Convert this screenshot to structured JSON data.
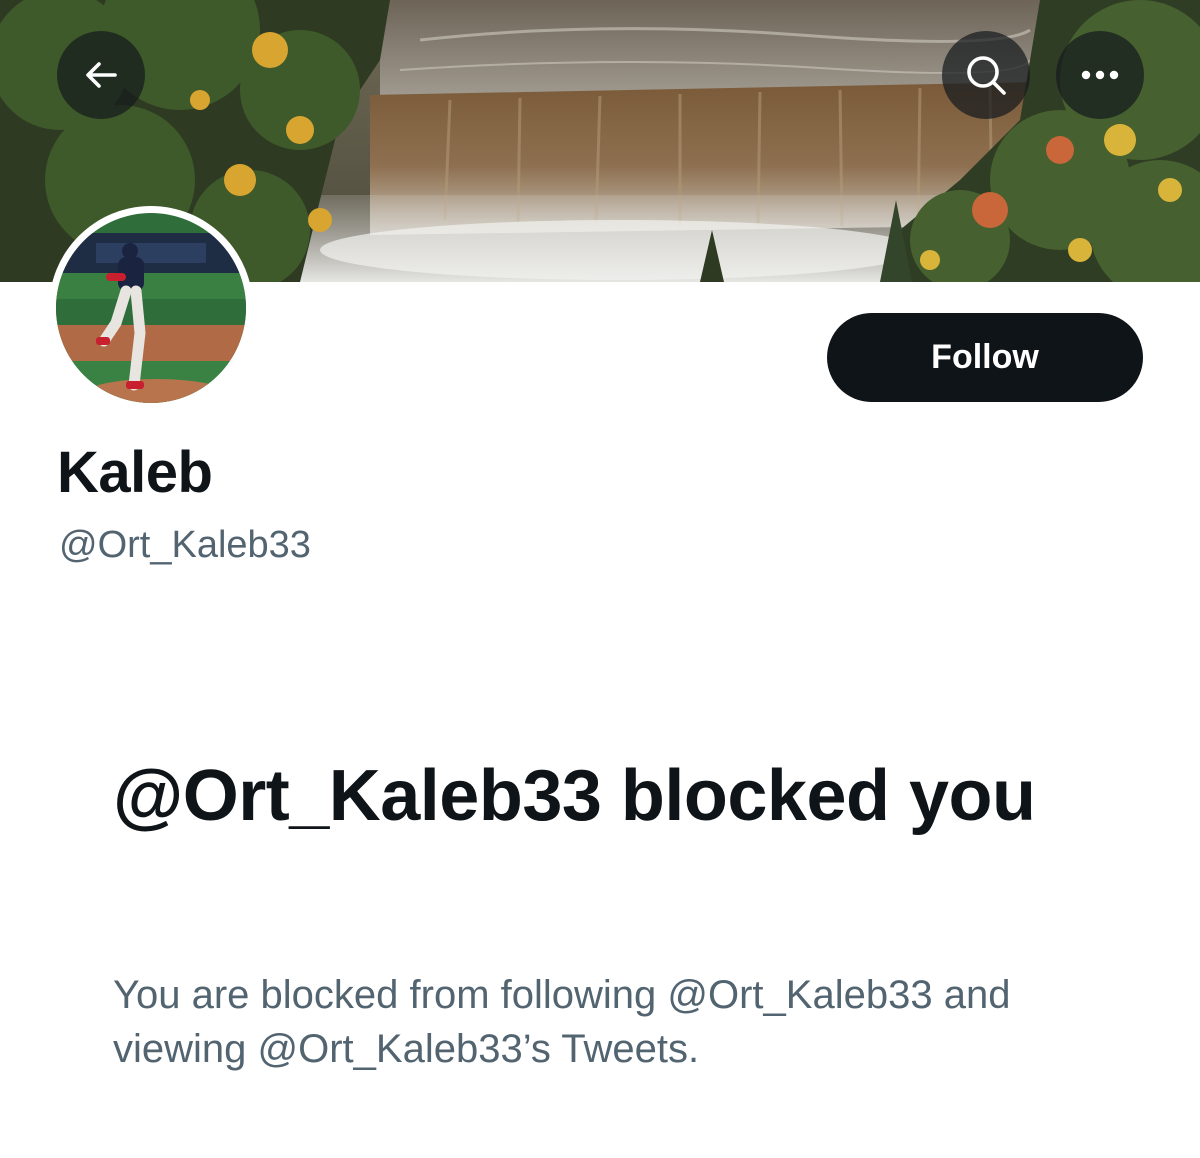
{
  "header": {
    "back_icon": "arrow-left-icon",
    "search_icon": "search-icon",
    "more_icon": "more-horizontal-icon"
  },
  "banner": {
    "scene": "waterfall-autumn-forest"
  },
  "profile": {
    "display_name": "Kaleb",
    "handle": "@Ort_Kaleb33",
    "follow_label": "Follow"
  },
  "blocked": {
    "title": "@Ort_Kaleb33 blocked you",
    "description": "You are blocked from following @Ort_Kaleb33 and viewing @Ort_Kaleb33’s Tweets."
  },
  "colors": {
    "text_primary": "#0f1419",
    "text_secondary": "#536471",
    "button_bg": "#0f1419",
    "button_text": "#ffffff",
    "background": "#ffffff"
  }
}
